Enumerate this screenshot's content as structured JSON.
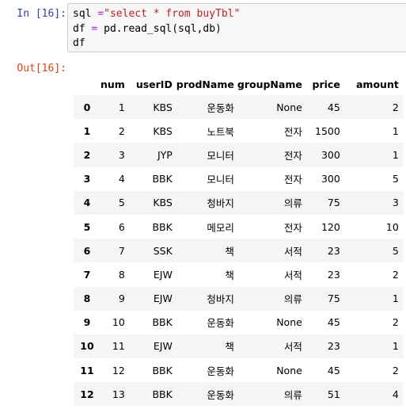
{
  "cell": {
    "in_prompt": "In [16]:",
    "out_prompt": "Out[16]:",
    "code": {
      "line1_var": "sql ",
      "line1_op": "=",
      "line1_str": "\"select * from buyTbl\"",
      "line2_a": "df ",
      "line2_op": "=",
      "line2_b": " pd.read_sql(sql,db)",
      "line3": "df"
    }
  },
  "dataframe": {
    "columns": [
      "num",
      "userID",
      "prodName",
      "groupName",
      "price",
      "amount"
    ],
    "rows": [
      {
        "index": "0",
        "num": "1",
        "userID": "KBS",
        "prodName": "운동화",
        "groupName": "None",
        "price": "45",
        "amount": "2"
      },
      {
        "index": "1",
        "num": "2",
        "userID": "KBS",
        "prodName": "노트북",
        "groupName": "전자",
        "price": "1500",
        "amount": "1"
      },
      {
        "index": "2",
        "num": "3",
        "userID": "JYP",
        "prodName": "모니터",
        "groupName": "전자",
        "price": "300",
        "amount": "1"
      },
      {
        "index": "3",
        "num": "4",
        "userID": "BBK",
        "prodName": "모니터",
        "groupName": "전자",
        "price": "300",
        "amount": "5"
      },
      {
        "index": "4",
        "num": "5",
        "userID": "KBS",
        "prodName": "청바지",
        "groupName": "의류",
        "price": "75",
        "amount": "3"
      },
      {
        "index": "5",
        "num": "6",
        "userID": "BBK",
        "prodName": "메모리",
        "groupName": "전자",
        "price": "120",
        "amount": "10"
      },
      {
        "index": "6",
        "num": "7",
        "userID": "SSK",
        "prodName": "책",
        "groupName": "서적",
        "price": "23",
        "amount": "5"
      },
      {
        "index": "7",
        "num": "8",
        "userID": "EJW",
        "prodName": "책",
        "groupName": "서적",
        "price": "23",
        "amount": "2"
      },
      {
        "index": "8",
        "num": "9",
        "userID": "EJW",
        "prodName": "청바지",
        "groupName": "의류",
        "price": "75",
        "amount": "1"
      },
      {
        "index": "9",
        "num": "10",
        "userID": "BBK",
        "prodName": "운동화",
        "groupName": "None",
        "price": "45",
        "amount": "2"
      },
      {
        "index": "10",
        "num": "11",
        "userID": "EJW",
        "prodName": "책",
        "groupName": "서적",
        "price": "23",
        "amount": "1"
      },
      {
        "index": "11",
        "num": "12",
        "userID": "BBK",
        "prodName": "운동화",
        "groupName": "None",
        "price": "45",
        "amount": "2"
      },
      {
        "index": "12",
        "num": "13",
        "userID": "BBK",
        "prodName": "운동화",
        "groupName": "의류",
        "price": "51",
        "amount": "4"
      }
    ]
  }
}
